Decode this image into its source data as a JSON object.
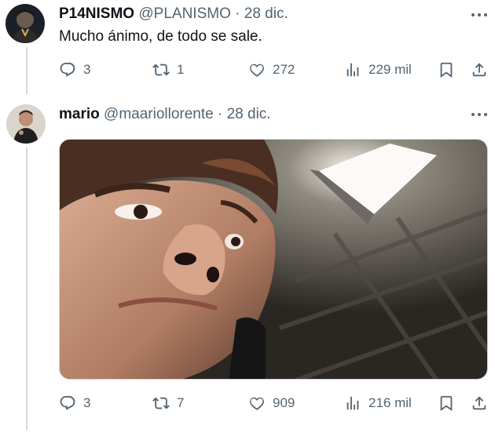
{
  "tweets": [
    {
      "name": "P14NISMO",
      "handle": "@PLANISMO",
      "time": "· 28 dic.",
      "text": "Mucho ánimo, de todo se sale.",
      "stats": {
        "replies": "3",
        "retweets": "1",
        "likes": "272",
        "views": "229 mil"
      }
    },
    {
      "name": "mario",
      "handle": "@maariollorente",
      "time": "· 28 dic.",
      "stats": {
        "replies": "3",
        "retweets": "7",
        "likes": "909",
        "views": "216 mil"
      }
    }
  ],
  "icons": {
    "reply": "reply-icon",
    "retweet": "retweet-icon",
    "like": "heart-icon",
    "views": "views-icon",
    "bookmark": "bookmark-icon",
    "share": "share-icon",
    "more": "more-icon"
  },
  "colors": {
    "text": "#0f1419",
    "secondary": "#536471",
    "thread_line": "#cfd9de"
  }
}
